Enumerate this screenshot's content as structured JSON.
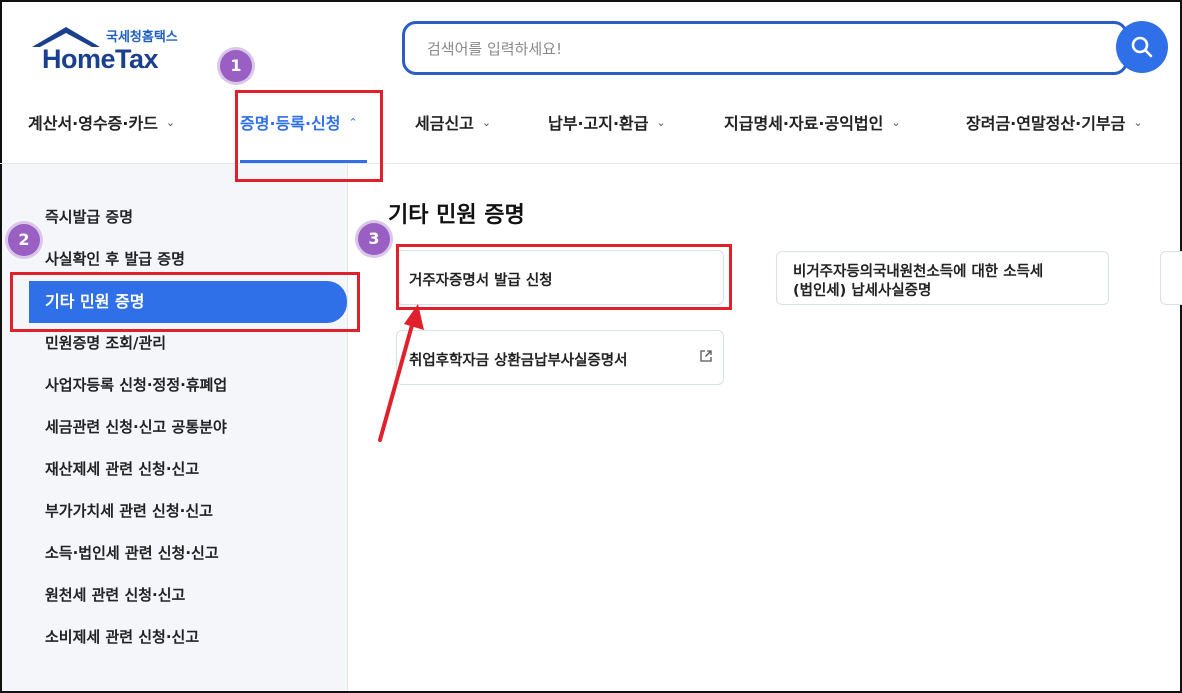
{
  "header": {
    "logo_sub": "국세청홈택스",
    "logo_main": "HomeTax",
    "search_placeholder": "검색어를 입력하세요!"
  },
  "nav": {
    "items": [
      {
        "label": "계산서·영수증·카드",
        "chevron": "⌄"
      },
      {
        "label": "증명·등록·신청",
        "chevron": "⌃",
        "active": true
      },
      {
        "label": "세금신고",
        "chevron": "⌄"
      },
      {
        "label": "납부·고지·환급",
        "chevron": "⌄"
      },
      {
        "label": "지급명세·자료·공익법인",
        "chevron": "⌄"
      },
      {
        "label": "장려금·연말정산·기부금",
        "chevron": "⌄"
      }
    ]
  },
  "sidebar": {
    "items": [
      {
        "label": "즉시발급 증명"
      },
      {
        "label": "사실확인 후 발급 증명"
      },
      {
        "label": "기타 민원 증명",
        "active": true
      },
      {
        "label": "민원증명 조회/관리"
      },
      {
        "label": "사업자등록 신청·정정·휴폐업"
      },
      {
        "label": "세금관련 신청·신고 공통분야"
      },
      {
        "label": "재산제세 관련 신청·신고"
      },
      {
        "label": "부가가치세 관련 신청·신고"
      },
      {
        "label": "소득·법인세 관련 신청·신고"
      },
      {
        "label": "원천세 관련 신청·신고"
      },
      {
        "label": "소비제세 관련 신청·신고"
      }
    ]
  },
  "main": {
    "title": "기타 민원 증명",
    "cards": [
      {
        "label": "거주자증명서 발급 신청"
      },
      {
        "label_line1": "비거주자등의국내원천소득에 대한 소득세",
        "label_line2": "(법인세) 납세사실증명"
      },
      {
        "label": "취업후학자금 상환금납부사실증명서",
        "icon": "external-link-icon"
      }
    ]
  },
  "annotations": {
    "badges": [
      "1",
      "2",
      "3"
    ],
    "highlight_color": "#e0202a",
    "badge_color": "#9a5fc2"
  },
  "colors": {
    "accent": "#2f6fe8",
    "brand_dark": "#1b3f8f"
  }
}
